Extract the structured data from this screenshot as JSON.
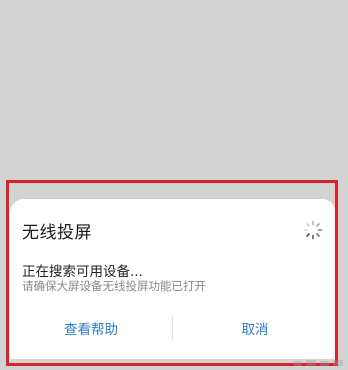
{
  "dialog": {
    "title": "无线投屏",
    "status": "正在搜索可用设备...",
    "hint": "请确保大屏设备无线投屏功能已打开",
    "buttons": {
      "help": "查看帮助",
      "cancel": "取消"
    },
    "spinner_icon": "loading-spinner-icon"
  },
  "colors": {
    "overlay": "#d3d3d3",
    "dialog_bg": "#ffffff",
    "button_text": "#2f7dc9",
    "highlight_frame": "#d8232a",
    "hint_text": "#8a8a8a"
  }
}
